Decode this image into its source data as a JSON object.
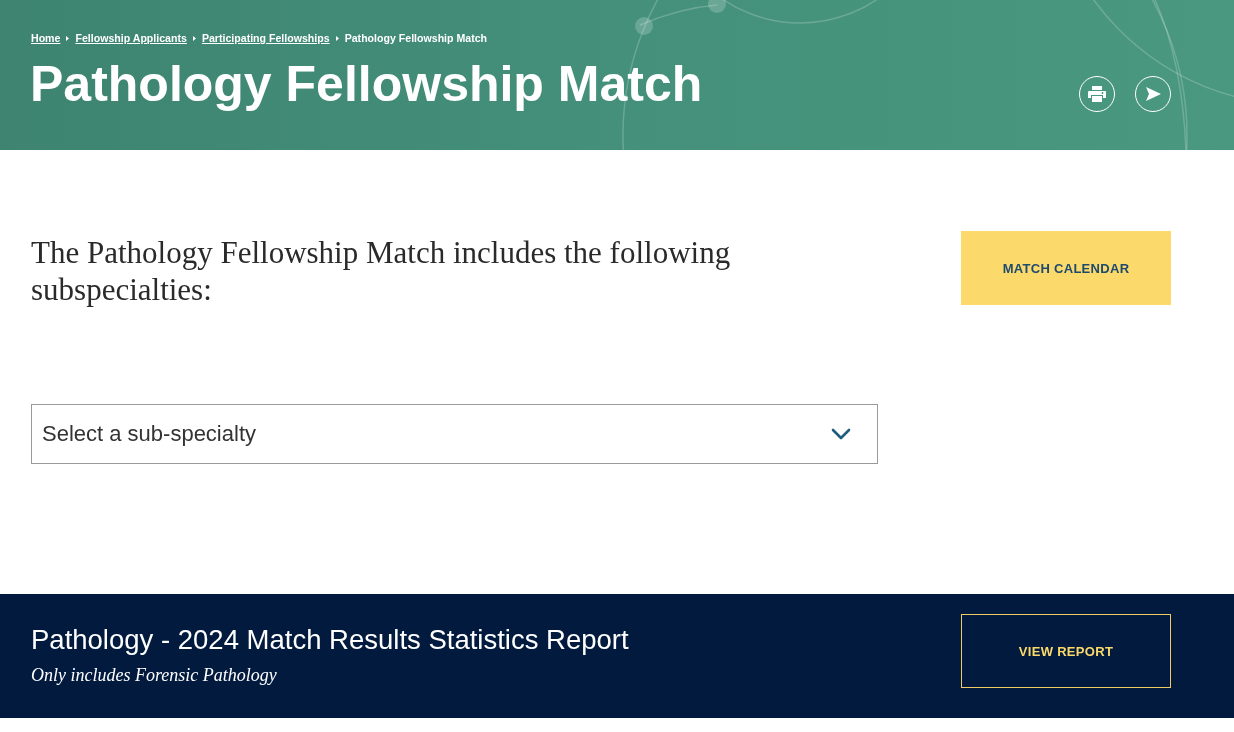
{
  "header": {
    "breadcrumb": [
      {
        "label": "Home",
        "current": false
      },
      {
        "label": "Fellowship Applicants",
        "current": false
      },
      {
        "label": "Participating Fellowships",
        "current": false
      },
      {
        "label": "Pathology Fellowship Match",
        "current": true
      }
    ],
    "title": "Pathology Fellowship Match",
    "actions": [
      {
        "kind": "print"
      },
      {
        "kind": "share"
      }
    ]
  },
  "intro": {
    "text": "The Pathology Fellowship Match includes the following subspecialties:",
    "button": "MATCH CALENDAR"
  },
  "subspecialty_select": {
    "placeholder": "Select a sub-specialty"
  },
  "report_banner": {
    "title": "Pathology - 2024 Match Results Statistics Report",
    "note": "Only includes Forensic Pathology",
    "button": "VIEW REPORT"
  }
}
